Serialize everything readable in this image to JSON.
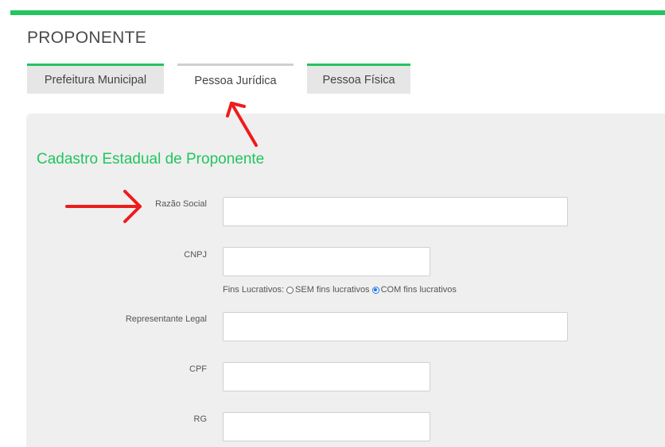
{
  "page": {
    "title": "PROPONENTE"
  },
  "tabs": [
    {
      "label": "Prefeitura Municipal",
      "active": false
    },
    {
      "label": "Pessoa Jurídica",
      "active": true
    },
    {
      "label": "Pessoa Física",
      "active": false
    }
  ],
  "form": {
    "section_title": "Cadastro Estadual de Proponente",
    "fields": {
      "razao_social": {
        "label": "Razão Social",
        "value": ""
      },
      "cnpj": {
        "label": "CNPJ",
        "value": ""
      },
      "representante": {
        "label": "Representante Legal",
        "value": ""
      },
      "cpf": {
        "label": "CPF",
        "value": ""
      },
      "rg": {
        "label": "RG",
        "value": ""
      }
    },
    "fins_lucrativos": {
      "label": "Fins Lucrativos:",
      "options": [
        {
          "label": "SEM fins lucrativos",
          "checked": false
        },
        {
          "label": "COM fins lucrativos",
          "checked": true
        }
      ]
    }
  },
  "colors": {
    "accent": "#22c55e",
    "annotation": "#ee1c1c",
    "panel": "#efefef"
  }
}
